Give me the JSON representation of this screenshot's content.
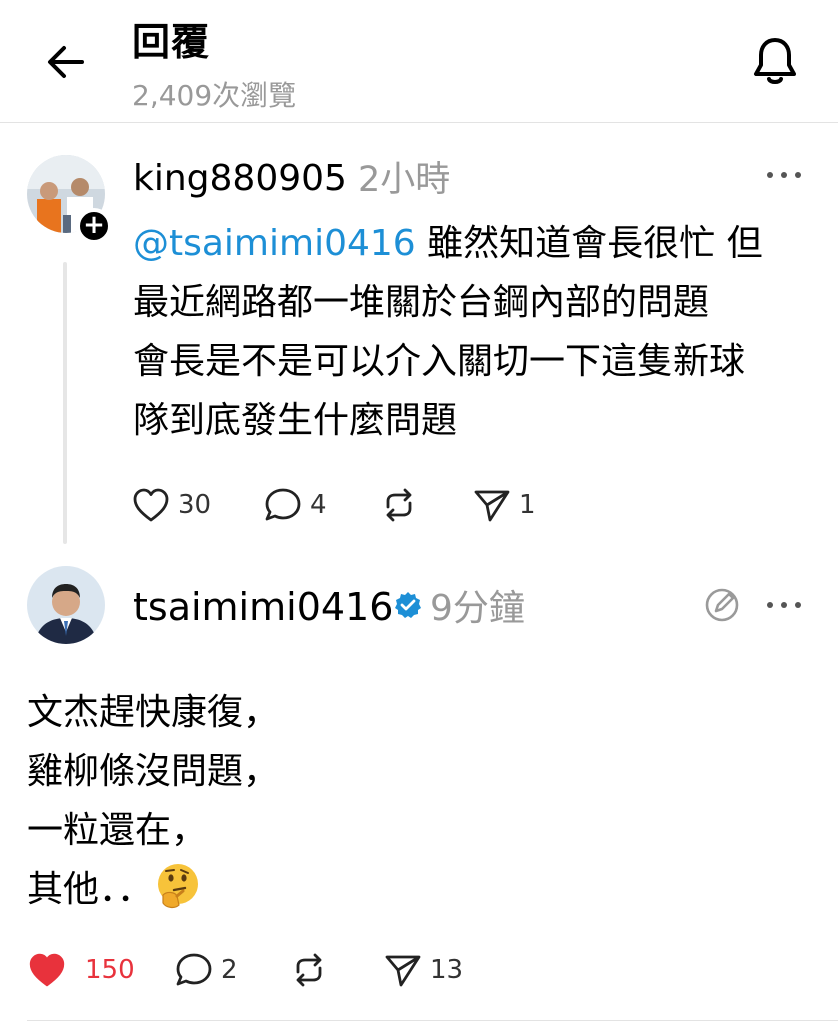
{
  "header": {
    "title": "回覆",
    "views": "2,409次瀏覽"
  },
  "post1": {
    "username": "king880905",
    "time": "2小時",
    "mention": "@tsaimimi0416",
    "text_lines": [
      " 雖然知道會長很忙 但",
      "最近網路都一堆關於台鋼內部的問題",
      "會長是不是可以介入關切一下這隻新球",
      "隊到底發生什麼問題"
    ],
    "likes": "30",
    "comments": "4",
    "shares": "1"
  },
  "post2": {
    "username": "tsaimimi0416",
    "time": "9分鐘",
    "text_lines": [
      "文杰趕快康復，",
      "雞柳條沒問題，",
      "一粒還在，",
      "其他．．"
    ],
    "likes": "150",
    "comments": "2",
    "shares": "13"
  },
  "colors": {
    "mention": "#1d8fd6",
    "liked": "#e8323c",
    "muted": "#999999",
    "verified": "#1d8fd6"
  },
  "icons": {
    "back": "arrow-left-icon",
    "bell": "bell-icon",
    "more": "more-horizontal-icon",
    "heart": "heart-icon",
    "comment": "comment-icon",
    "repost": "repost-icon",
    "share": "send-icon",
    "verified": "verified-badge-icon",
    "edit": "edit-icon",
    "emoji": "thinking-face-emoji"
  }
}
